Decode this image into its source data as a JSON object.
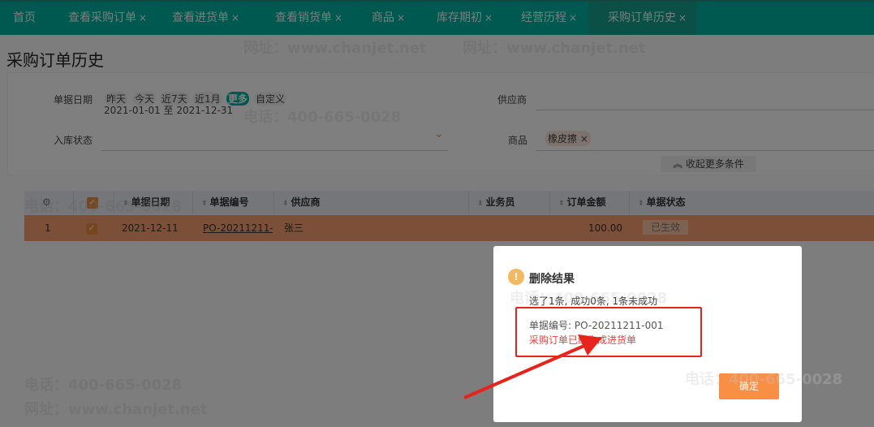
{
  "tabs": [
    {
      "label": "首页",
      "closable": false
    },
    {
      "label": "查看采购订单",
      "closable": true
    },
    {
      "label": "查看进货单",
      "closable": true
    },
    {
      "label": "查看销货单",
      "closable": true
    },
    {
      "label": "商品",
      "closable": true
    },
    {
      "label": "库存期初",
      "closable": true
    },
    {
      "label": "经营历程",
      "closable": true
    },
    {
      "label": "采购订单历史",
      "closable": true,
      "active": true
    }
  ],
  "close_glyph": "×",
  "page_title": "采购订单历史",
  "filters": {
    "date_label": "单据日期",
    "date_chips": [
      "昨天",
      "今天",
      "近7天",
      "近1月",
      "更多",
      "自定义"
    ],
    "date_active": "更多",
    "date_range": "2021-01-01 至 2021-12-31",
    "status_label": "入库状态",
    "supplier_label": "供应商",
    "product_label": "商品",
    "product_tag": "橡皮擦",
    "collapse_label": "收起更多条件"
  },
  "table": {
    "columns": [
      "单据日期",
      "单据编号",
      "供应商",
      "业务员",
      "订单金额",
      "单据状态"
    ],
    "rows": [
      {
        "index": "1",
        "checked": true,
        "date": "2021-12-11",
        "number": "PO-20211211-(",
        "supplier": "张三",
        "salesman": "",
        "amount": "100.00",
        "status": "已生效"
      }
    ]
  },
  "dialog": {
    "title": "删除结果",
    "summary": "选了1条, 成功0条, 1条未成功",
    "doc_number": "单据编号: PO-20211211-001",
    "error": "采购订单已经生成进货单",
    "ok_label": "确定"
  },
  "watermark": {
    "phone": "电话：400-665-0028",
    "site": "网址：www.chanjet.net"
  },
  "colors": {
    "accent": "#00b3a0",
    "warning": "#f0a040",
    "error": "#e84040",
    "button": "#f08c3c",
    "annotation": "#e8231c"
  }
}
